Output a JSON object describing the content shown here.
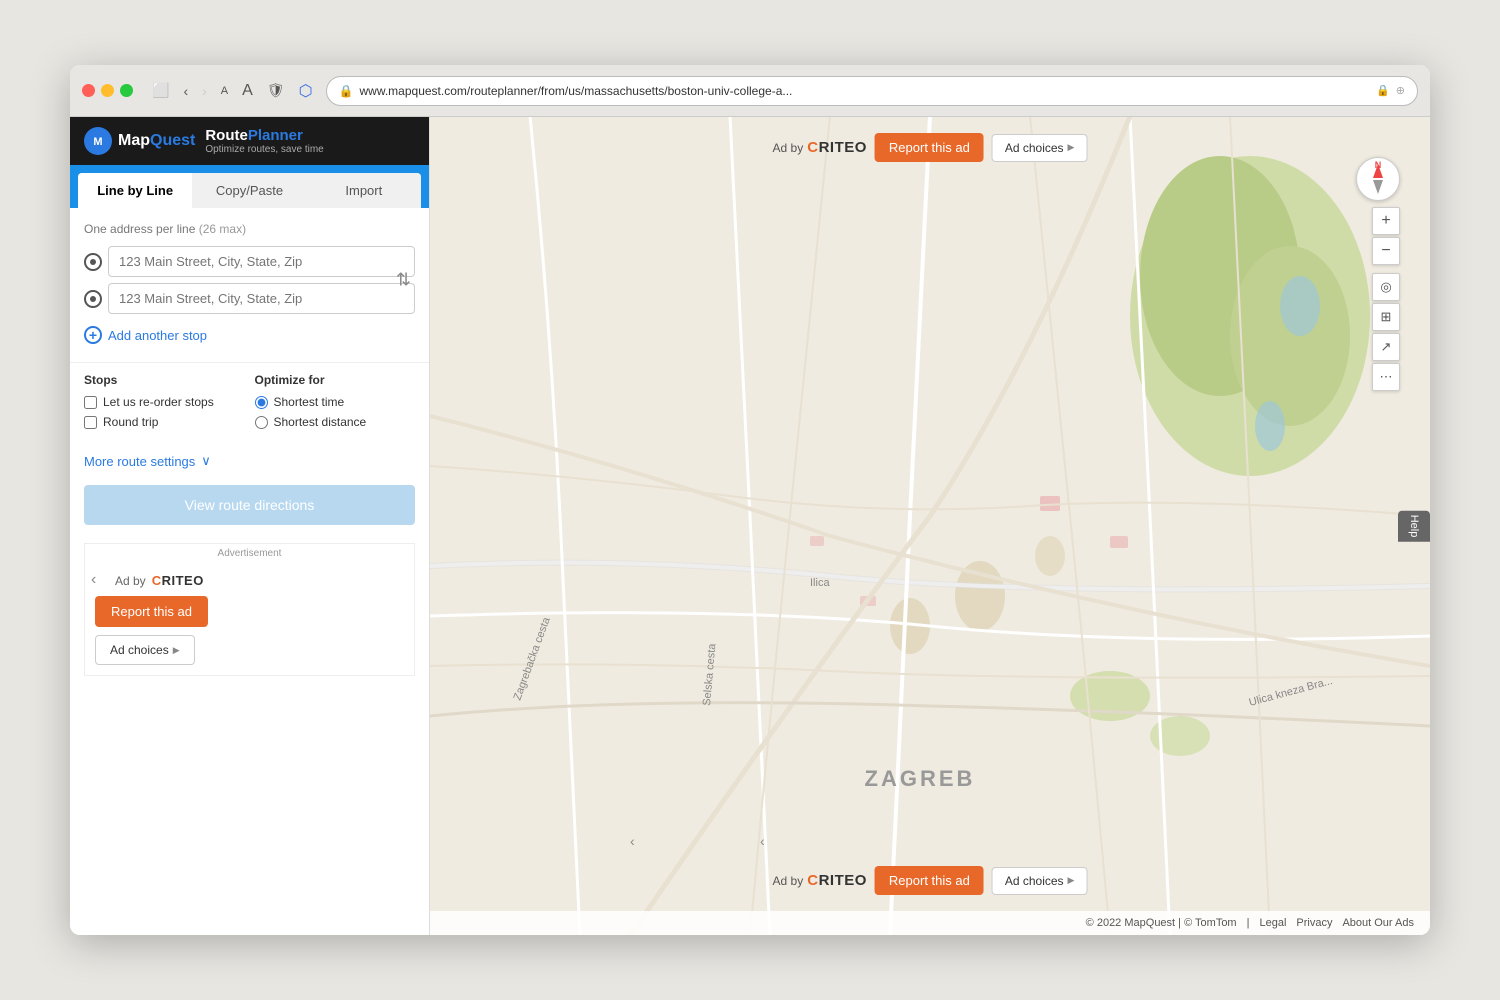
{
  "browser": {
    "url": "www.mapquest.com/routeplanner/from/us/massachusetts/boston-univ-college-a...",
    "back_label": "‹",
    "forward_label": "›"
  },
  "header": {
    "logo_icon": "M",
    "logo_name": "MapQuest",
    "logo_map": "Map",
    "logo_quest": "Quest",
    "route_planner_title": "Route",
    "route_planner_title2": "Planner",
    "route_planner_subtitle": "Optimize routes, save time"
  },
  "tabs": [
    {
      "id": "line-by-line",
      "label": "Line by Line",
      "active": true
    },
    {
      "id": "copy-paste",
      "label": "Copy/Paste",
      "active": false
    },
    {
      "id": "import",
      "label": "Import",
      "active": false
    }
  ],
  "form": {
    "address_hint": "One address per line",
    "address_hint_max": "(26 max)",
    "input1_placeholder": "123 Main Street, City, State, Zip",
    "input2_placeholder": "123 Main Street, City, State, Zip",
    "add_stop_label": "Add another stop",
    "swap_icon": "⇅"
  },
  "stops_section": {
    "stops_label": "Stops",
    "optimize_label": "Optimize for",
    "reorder_label": "Let us re-order stops",
    "round_trip_label": "Round trip",
    "shortest_time_label": "Shortest time",
    "shortest_distance_label": "Shortest distance"
  },
  "more_settings": {
    "label": "More route settings",
    "chevron": "∨"
  },
  "view_directions": {
    "label": "View route directions"
  },
  "sidebar_ad": {
    "advertisement_label": "Advertisement",
    "back_icon": "‹",
    "ad_by": "Ad by",
    "criteo_name": "CRITEO",
    "report_btn": "Report this ad",
    "choices_btn": "Ad choices",
    "choices_icon": "▶"
  },
  "map_ad_top": {
    "ad_by": "Ad by",
    "criteo_name": "CRITEO",
    "report_btn": "Report this ad",
    "choices_btn": "Ad choices",
    "choices_icon": "▶"
  },
  "map_ad_bottom": {
    "ad_by": "Ad by",
    "criteo_name": "CRITEO",
    "report_btn": "Report this ad",
    "choices_btn": "Ad choices",
    "choices_icon": "▶"
  },
  "map_controls": {
    "zoom_in": "+",
    "zoom_out": "−",
    "locate": "◎",
    "layers": "⊞",
    "share": "↗",
    "compass_n": "N"
  },
  "map_city": "ZAGREB",
  "footer": {
    "copyright": "© 2022 MapQuest | © TomTom",
    "legal": "Legal",
    "privacy": "Privacy",
    "about": "About Our Ads"
  },
  "help_tab": "Help",
  "collapse_icon": "‹"
}
